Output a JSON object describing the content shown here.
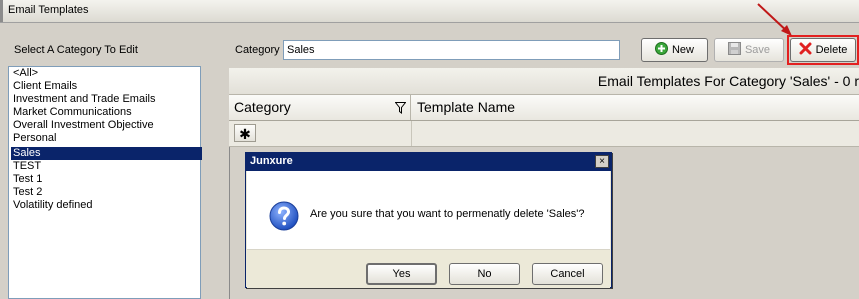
{
  "window": {
    "title": "Email Templates"
  },
  "category_panel": {
    "title": "Select A Category To Edit",
    "items": [
      {
        "label": "<All>"
      },
      {
        "label": "Client Emails"
      },
      {
        "label": "Investment and Trade Emails"
      },
      {
        "label": "Market Communications"
      },
      {
        "label": "Overall Investment Objective"
      },
      {
        "label": "Personal"
      },
      {
        "label": "Sales",
        "selected": true
      },
      {
        "label": "TEST"
      },
      {
        "label": "Test 1"
      },
      {
        "label": "Test 2"
      },
      {
        "label": "Volatility defined"
      }
    ]
  },
  "toolbar": {
    "category_label": "Category",
    "category_value": "Sales",
    "new_label": "New",
    "save_label": "Save",
    "delete_label": "Delete"
  },
  "grid": {
    "caption": "Email Templates For Category 'Sales' - 0 r",
    "columns": [
      "Category",
      "Template Name"
    ],
    "new_row_marker": "✱"
  },
  "dialog": {
    "title": "Junxure",
    "close_glyph": "×",
    "message": "Are you sure that you want to permenatly delete 'Sales'?",
    "yes_label": "Yes",
    "no_label": "No",
    "cancel_label": "Cancel"
  },
  "colors": {
    "selection": "#0a246a",
    "highlight": "#e32020",
    "dialog_title": "#0a246a"
  }
}
